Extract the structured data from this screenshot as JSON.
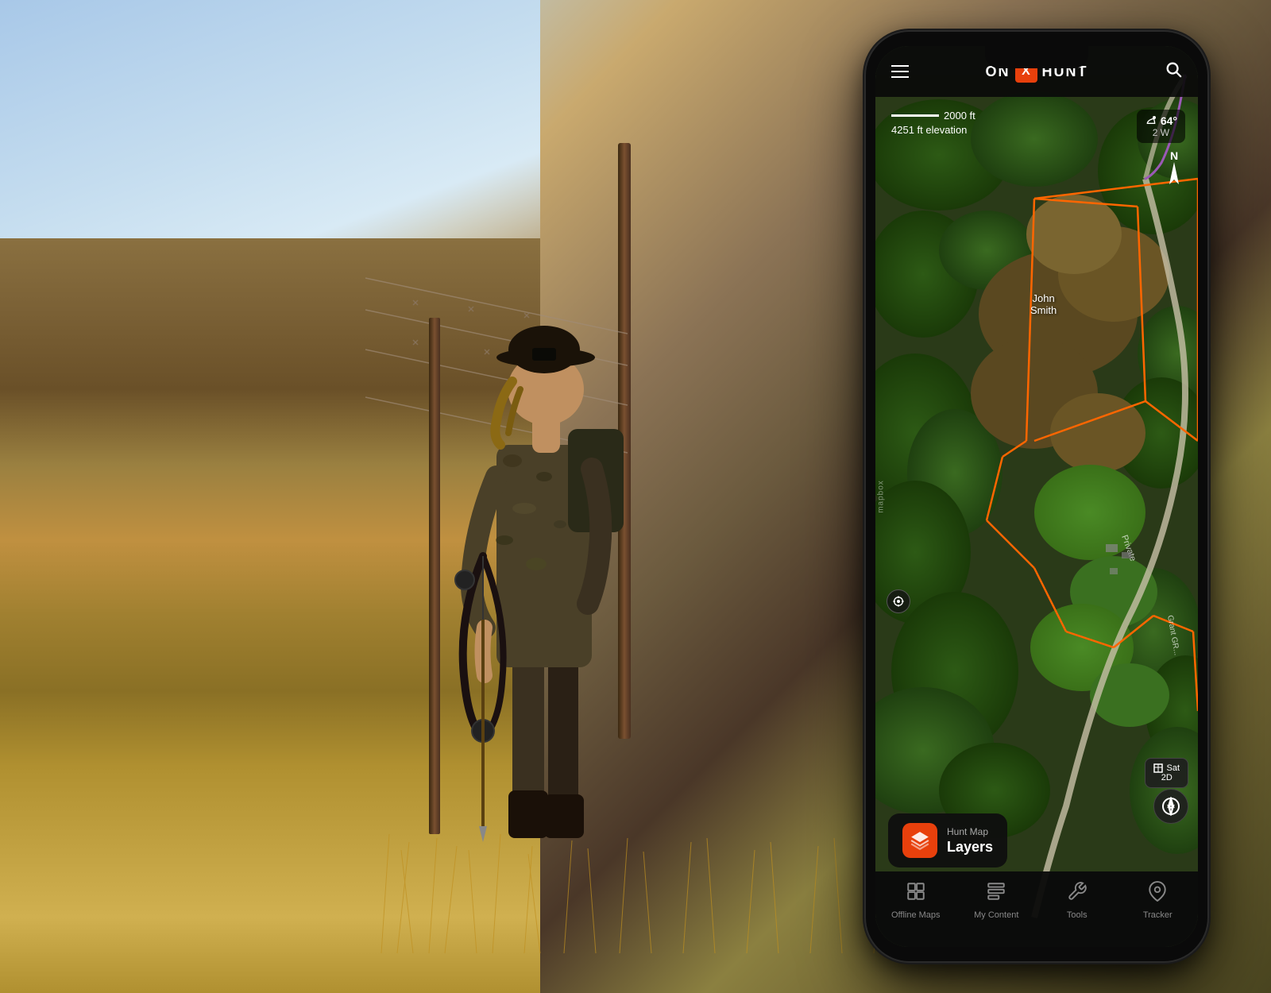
{
  "background": {
    "sky_color": "#a8c8e8",
    "ground_color": "#8a7040"
  },
  "phone": {
    "app_name": "ON X HUNT",
    "logo_on": "ON",
    "logo_x": "X",
    "logo_hunt": "HUNT"
  },
  "map": {
    "scale_label": "2000 ft",
    "elevation_label": "4251 ft elevation",
    "compass_label": "N",
    "weather_temp": "64°",
    "weather_wind": "2 W",
    "land_owner_label": "John\nSmith",
    "private_label": "Private",
    "grant_label": "Grant GR",
    "sat_label": "Sat",
    "view_2d": "2D",
    "mapbox_label": "mapbox"
  },
  "layers_button": {
    "top_label": "Hunt Map",
    "bottom_label": "Layers"
  },
  "bottom_nav": {
    "items": [
      {
        "label": "Offline Maps",
        "icon": "⊞"
      },
      {
        "label": "My Content",
        "icon": "☰"
      },
      {
        "label": "Tools",
        "icon": "✦"
      },
      {
        "label": "Tracker",
        "icon": "⌖"
      }
    ]
  }
}
